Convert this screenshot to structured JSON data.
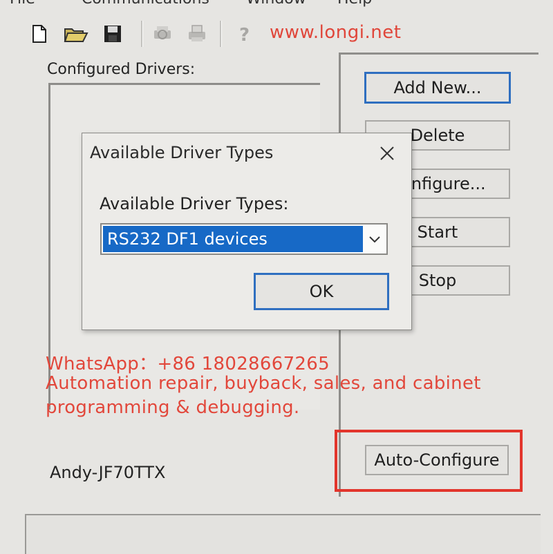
{
  "menu": {
    "items": [
      "File",
      "Communications",
      "Window",
      "Help"
    ]
  },
  "watermark": {
    "url": "www.longi.net",
    "whatsapp": "WhatsApp：+86 18028667265",
    "service_line1": "Automation repair, buyback, sales, and cabinet",
    "service_line2": "programming & debugging."
  },
  "toolbar": {
    "icons": [
      "new-file-icon",
      "open-folder-icon",
      "save-icon",
      "print-preview-icon",
      "print-icon",
      "help-icon"
    ]
  },
  "configured_drivers": {
    "label": "Configured Drivers:"
  },
  "buttons": {
    "add_new": "Add New...",
    "delete": "Delete",
    "configure": "Configure...",
    "start": "Start",
    "stop": "Stop",
    "auto_configure": "Auto-Configure"
  },
  "dialog": {
    "title": "Available Driver Types",
    "label": "Available Driver Types:",
    "selected_value": "RS232 DF1 devices",
    "ok_label": "OK"
  },
  "computer_name": "Andy-JF70TTX",
  "colors": {
    "accent_blue": "#2f6fc0",
    "selection_blue": "#1769c6",
    "watermark_red": "#e2473b",
    "highlight_box_red": "#e2352c",
    "window_bg": "#e6e5e2"
  }
}
